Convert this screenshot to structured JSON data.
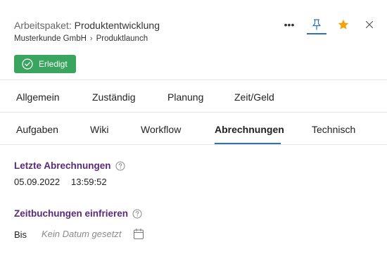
{
  "header": {
    "title_prefix": "Arbeitspaket:",
    "title_name": "Produktentwicklung",
    "breadcrumb": [
      "Musterkunde GmbH",
      "Produktlaunch"
    ],
    "breadcrumb_separator": "›",
    "status_label": "Erledigt",
    "more_label": "•••",
    "colors": {
      "status": "#3aa55e",
      "star": "#f0a30a",
      "accent": "#2f6fc0",
      "section_title": "#5a2a7a"
    },
    "icons": [
      "more-icon",
      "pin-icon",
      "star-icon",
      "close-icon"
    ]
  },
  "tabs_row1": [
    "Allgemein",
    "Zuständig",
    "Planung",
    "Zeit/Geld"
  ],
  "tabs_row2": [
    "Aufgaben",
    "Wiki",
    "Workflow",
    "Abrechnungen",
    "Technisch"
  ],
  "active_tab": "Abrechnungen",
  "billing": {
    "last_title": "Letzte Abrechnungen",
    "last_date": "05.09.2022",
    "last_time": "13:59:52",
    "freeze_title": "Zeitbuchungen einfrieren",
    "until_label": "Bis",
    "date_placeholder": "Kein Datum gesetzt"
  }
}
